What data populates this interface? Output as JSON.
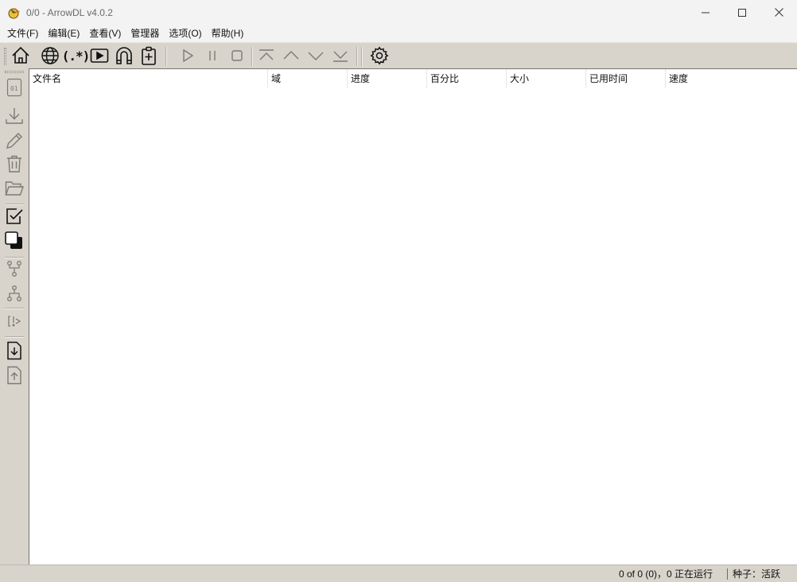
{
  "window": {
    "title": "0/0 - ArrowDL v4.0.2",
    "controls": [
      "minimize-icon",
      "maximize-icon",
      "close-icon"
    ]
  },
  "menubar": {
    "items": [
      "文件(F)",
      "编辑(E)",
      "查看(V)",
      "管理器",
      "选项(O)",
      "帮助(H)"
    ]
  },
  "toolbar": {
    "icons": [
      "home-icon",
      "globe-icon",
      "regex-icon",
      "video-icon",
      "magnet-icon",
      "clipboard-add-icon",
      "play-icon",
      "pause-icon",
      "stop-icon",
      "move-top-icon",
      "move-up-icon",
      "move-down-icon",
      "move-bottom-icon",
      "settings-icon"
    ],
    "regex_label": "(.*)"
  },
  "sidebar": {
    "icons": [
      "binary-file-icon",
      "download-icon",
      "edit-icon",
      "trash-icon",
      "open-folder-icon",
      "checkbox-icon",
      "select-all-icon",
      "expand-tree-icon",
      "collapse-tree-icon",
      "priority-icon",
      "import-icon",
      "export-icon"
    ],
    "binary_label": "01"
  },
  "table": {
    "columns": [
      "文件名",
      "域",
      "进度",
      "百分比",
      "大小",
      "已用时间",
      "速度"
    ],
    "rows": []
  },
  "statusbar": {
    "summary": "0 of 0 (0)，0 正在运行",
    "torrent": "种子：活跃"
  },
  "colors": {
    "chrome": "#d8d4cc",
    "titlebar": "#f3f3f3",
    "content": "#ffffff"
  }
}
